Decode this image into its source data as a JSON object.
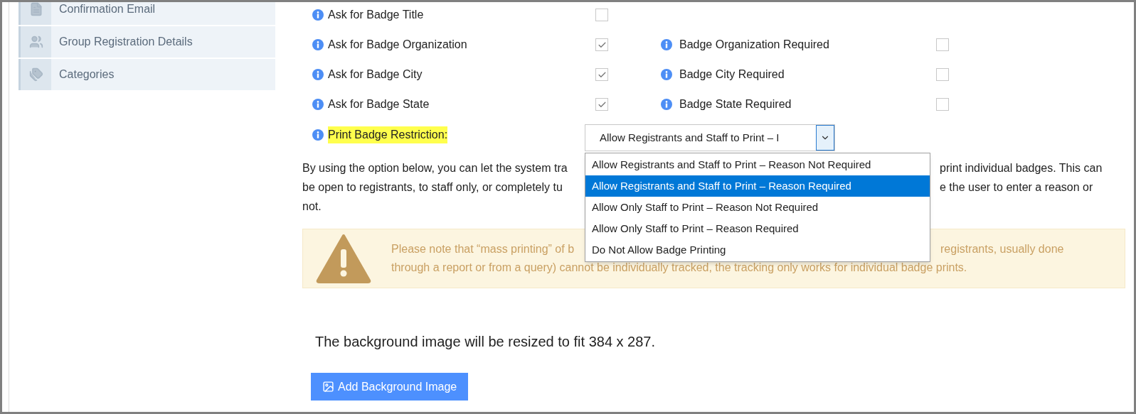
{
  "sidebar": {
    "items": [
      {
        "label": "Confirmation Email"
      },
      {
        "label": "Group Registration Details"
      },
      {
        "label": "Categories"
      }
    ]
  },
  "fields": [
    {
      "label": "Ask for Badge Title",
      "checked": false
    },
    {
      "label": "Ask for Badge Organization",
      "checked": true,
      "required": {
        "label": "Badge Organization Required",
        "checked": false
      }
    },
    {
      "label": "Ask for Badge City",
      "checked": true,
      "required": {
        "label": "Badge City Required",
        "checked": false
      }
    },
    {
      "label": "Ask for Badge State",
      "checked": true,
      "required": {
        "label": "Badge State Required",
        "checked": false
      }
    }
  ],
  "print_restriction": {
    "label": "Print Badge Restriction:",
    "highlighted": true,
    "value": "Allow Registrants and Staff to Print – I",
    "expanded": true,
    "options": [
      {
        "label": "Allow Registrants and Staff to Print – Reason Not Required",
        "selected": false
      },
      {
        "label": "Allow Registrants and Staff to Print – Reason Required",
        "selected": true
      },
      {
        "label": "Allow Only Staff to Print – Reason Not Required",
        "selected": false
      },
      {
        "label": "Allow Only Staff to Print – Reason Required",
        "selected": false
      },
      {
        "label": "Do Not Allow Badge Printing",
        "selected": false
      }
    ]
  },
  "description": {
    "lines": [
      {
        "left": "By using the option below, you can let the system tra",
        "right": "print individual badges. This can"
      },
      {
        "left": "be open to registrants, to staff only, or completely tu",
        "right": "e the user to enter a reason or"
      },
      {
        "left": "not."
      }
    ]
  },
  "warning": {
    "lines": [
      {
        "left": "Please note that “mass printing” of b",
        "right": "registrants, usually done"
      },
      {
        "left": "through a report or from a query) cannot be individually tracked, the tracking only works for individual badge prints."
      }
    ]
  },
  "background_note": "The background image will be resized to fit 384 x 287.",
  "add_button": "Add Background Image"
}
